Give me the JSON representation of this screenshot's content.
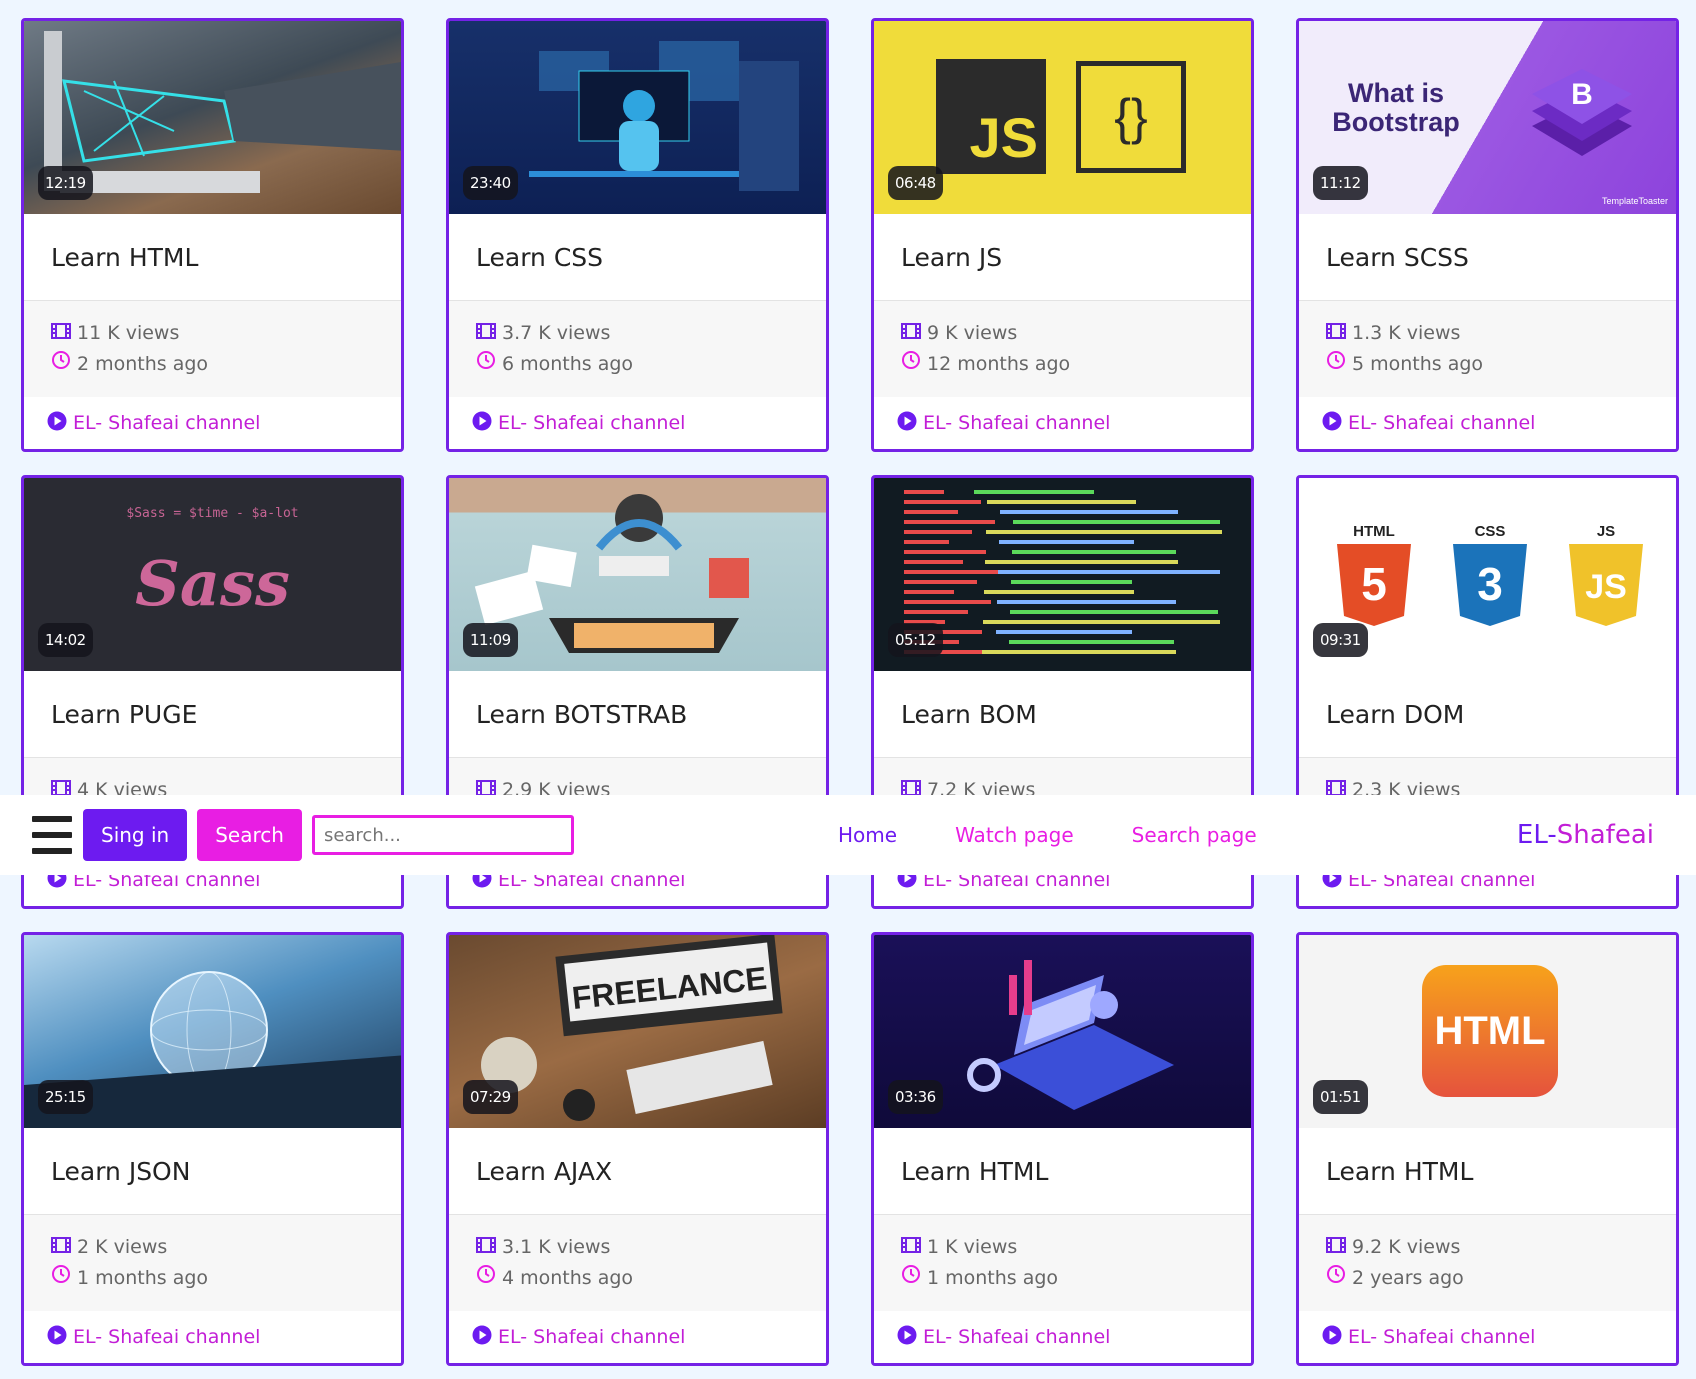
{
  "navbar": {
    "sign_in_label": "Sing in",
    "search_button_label": "Search",
    "search_placeholder": "search...",
    "links": {
      "home": "Home",
      "watch": "Watch page",
      "search": "Search page"
    },
    "brand_part1": "EL-",
    "brand_part2": " Shafeai"
  },
  "colors": {
    "accent_purple": "#6d1bf0",
    "accent_pink": "#e81ee3",
    "card_border": "#7422e6"
  },
  "videos": [
    {
      "title": "Learn HTML",
      "duration": "12:19",
      "views": "11 K views",
      "age": "2 months ago",
      "channel": "EL- Shafeai channel",
      "thumb": "hand-laptop"
    },
    {
      "title": "Learn CSS",
      "duration": "23:40",
      "views": "3.7 K views",
      "age": "6 months ago",
      "channel": "EL- Shafeai channel",
      "thumb": "developer-desk"
    },
    {
      "title": "Learn JS",
      "duration": "06:48",
      "views": "9 K views",
      "age": "12 months ago",
      "channel": "EL- Shafeai channel",
      "thumb": "js-logo",
      "thumb_text": "JS",
      "thumb_text2": "{}"
    },
    {
      "title": "Learn SCSS",
      "duration": "11:12",
      "views": "1.3 K views",
      "age": "5 months ago",
      "channel": "EL- Shafeai channel",
      "thumb": "bootstrap",
      "thumb_text": "What is Bootstrap",
      "thumb_text2": "TemplateToaster"
    },
    {
      "title": "Learn PUGE",
      "duration": "14:02",
      "views": "4 K views",
      "age": "",
      "channel": "EL- Shafeai channel",
      "thumb": "sass",
      "thumb_text": "$Sass = $time - $a-lot",
      "thumb_text2": "Sass"
    },
    {
      "title": "Learn BOTSTRAB",
      "duration": "11:09",
      "views": "2.9 K views",
      "age": "",
      "channel": "EL- Shafeai channel",
      "thumb": "workspace"
    },
    {
      "title": "Learn BOM",
      "duration": "05:12",
      "views": "7.2 K views",
      "age": "",
      "channel": "EL- Shafeai channel",
      "thumb": "code"
    },
    {
      "title": "Learn DOM",
      "duration": "09:31",
      "views": "2.3 K views",
      "age": "",
      "channel": "EL- Shafeai channel",
      "thumb": "html-css-js",
      "thumb_text": "HTML",
      "thumb_text2": "CSS",
      "thumb_text3": "JS"
    },
    {
      "title": "Learn JSON",
      "duration": "25:15",
      "views": "2 K views",
      "age": "1 months ago",
      "channel": "EL- Shafeai channel",
      "thumb": "globe"
    },
    {
      "title": "Learn AJAX",
      "duration": "07:29",
      "views": "3.1 K views",
      "age": "4 months ago",
      "channel": "EL- Shafeai channel",
      "thumb": "freelance",
      "thumb_text": "FREELANCE"
    },
    {
      "title": "Learn HTML",
      "duration": "03:36",
      "views": "1 K views",
      "age": "1 months ago",
      "channel": "EL- Shafeai channel",
      "thumb": "isometric"
    },
    {
      "title": "Learn HTML",
      "duration": "01:51",
      "views": "9.2 K views",
      "age": "2 years ago",
      "channel": "EL- Shafeai channel",
      "thumb": "html-app",
      "thumb_text": "HTML"
    }
  ]
}
